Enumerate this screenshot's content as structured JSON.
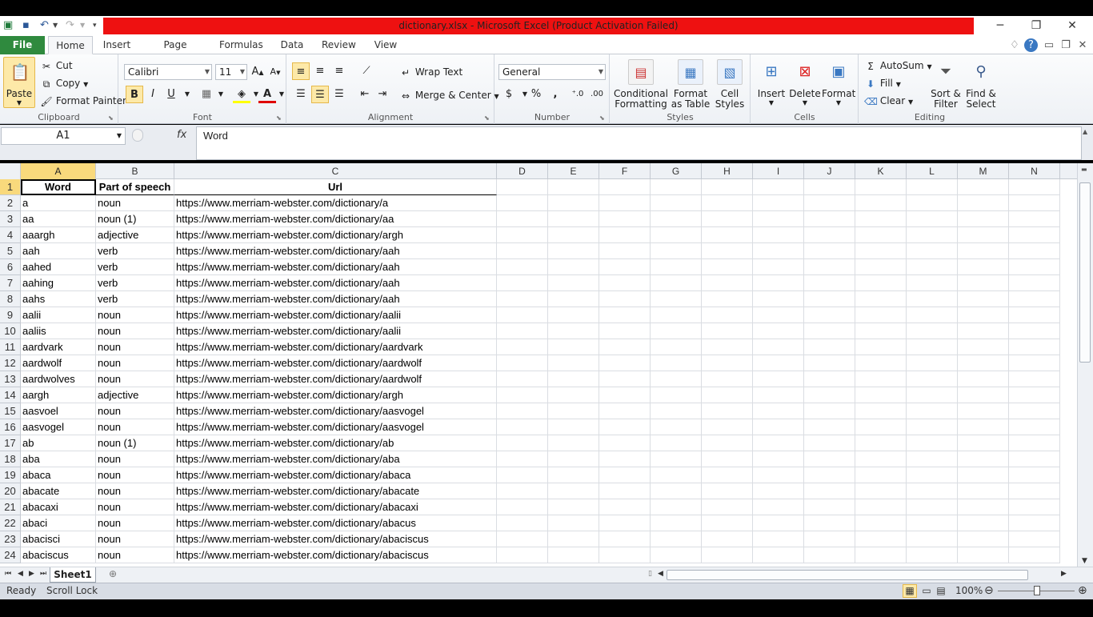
{
  "title": "dictionary.xlsx  -  Microsoft Excel (Product Activation Failed)",
  "tabs": [
    "File",
    "Home",
    "Insert",
    "Page Layout",
    "Formulas",
    "Data",
    "Review",
    "View"
  ],
  "clipboard": {
    "paste": "Paste",
    "cut": "Cut",
    "copy": "Copy",
    "format_painter": "Format Painter",
    "label": "Clipboard"
  },
  "font": {
    "name": "Calibri",
    "size": "11",
    "bold": "B",
    "italic": "I",
    "underline": "U",
    "label": "Font"
  },
  "alignment": {
    "wrap": "Wrap Text",
    "merge": "Merge & Center",
    "label": "Alignment"
  },
  "number": {
    "format": "General",
    "percent": "%",
    "comma": ",",
    "label": "Number"
  },
  "styles": {
    "conditional": "Conditional",
    "formatting": "Formatting",
    "format": "Format",
    "as_table": "as Table",
    "cell": "Cell",
    "cell_styles": "Styles",
    "label": "Styles"
  },
  "cells": {
    "insert": "Insert",
    "delete": "Delete",
    "format": "Format",
    "label": "Cells"
  },
  "editing": {
    "autosum": "AutoSum",
    "fill": "Fill",
    "clear": "Clear",
    "sort": "Sort &",
    "filter": "Filter",
    "find": "Find &",
    "select": "Select",
    "label": "Editing"
  },
  "formula_bar": {
    "name_box": "A1",
    "fx": "fx",
    "value": "Word"
  },
  "columns": [
    "A",
    "B",
    "C",
    "D",
    "E",
    "F",
    "G",
    "H",
    "I",
    "J",
    "K",
    "L",
    "M",
    "N"
  ],
  "rows": [
    [
      "1",
      "Word",
      "Part of speech",
      "Url"
    ],
    [
      "2",
      "a",
      "noun",
      "https://www.merriam-webster.com/dictionary/a"
    ],
    [
      "3",
      "aa",
      "noun (1)",
      "https://www.merriam-webster.com/dictionary/aa"
    ],
    [
      "4",
      "aaargh",
      "adjective",
      "https://www.merriam-webster.com/dictionary/argh"
    ],
    [
      "5",
      "aah",
      "verb",
      "https://www.merriam-webster.com/dictionary/aah"
    ],
    [
      "6",
      "aahed",
      "verb",
      "https://www.merriam-webster.com/dictionary/aah"
    ],
    [
      "7",
      "aahing",
      "verb",
      "https://www.merriam-webster.com/dictionary/aah"
    ],
    [
      "8",
      "aahs",
      "verb",
      "https://www.merriam-webster.com/dictionary/aah"
    ],
    [
      "9",
      "aalii",
      "noun",
      "https://www.merriam-webster.com/dictionary/aalii"
    ],
    [
      "10",
      "aaliis",
      "noun",
      "https://www.merriam-webster.com/dictionary/aalii"
    ],
    [
      "11",
      "aardvark",
      "noun",
      "https://www.merriam-webster.com/dictionary/aardvark"
    ],
    [
      "12",
      "aardwolf",
      "noun",
      "https://www.merriam-webster.com/dictionary/aardwolf"
    ],
    [
      "13",
      "aardwolves",
      "noun",
      "https://www.merriam-webster.com/dictionary/aardwolf"
    ],
    [
      "14",
      "aargh",
      "adjective",
      "https://www.merriam-webster.com/dictionary/argh"
    ],
    [
      "15",
      "aasvoel",
      "noun",
      "https://www.merriam-webster.com/dictionary/aasvogel"
    ],
    [
      "16",
      "aasvogel",
      "noun",
      "https://www.merriam-webster.com/dictionary/aasvogel"
    ],
    [
      "17",
      "ab",
      "noun (1)",
      "https://www.merriam-webster.com/dictionary/ab"
    ],
    [
      "18",
      "aba",
      "noun",
      "https://www.merriam-webster.com/dictionary/aba"
    ],
    [
      "19",
      "abaca",
      "noun",
      "https://www.merriam-webster.com/dictionary/abaca"
    ],
    [
      "20",
      "abacate",
      "noun",
      "https://www.merriam-webster.com/dictionary/abacate"
    ],
    [
      "21",
      "abacaxi",
      "noun",
      "https://www.merriam-webster.com/dictionary/abacaxi"
    ],
    [
      "22",
      "abaci",
      "noun",
      "https://www.merriam-webster.com/dictionary/abacus"
    ],
    [
      "23",
      "abacisci",
      "noun",
      "https://www.merriam-webster.com/dictionary/abaciscus"
    ],
    [
      "24",
      "abaciscus",
      "noun",
      "https://www.merriam-webster.com/dictionary/abaciscus"
    ]
  ],
  "sheet_tab": "Sheet1",
  "status": {
    "ready": "Ready",
    "scroll_lock": "Scroll Lock",
    "zoom": "100%"
  },
  "colors": {
    "title_bar": "#ee1111",
    "file_tab": "#2f8a3e",
    "active_header": "#f9d97c"
  }
}
